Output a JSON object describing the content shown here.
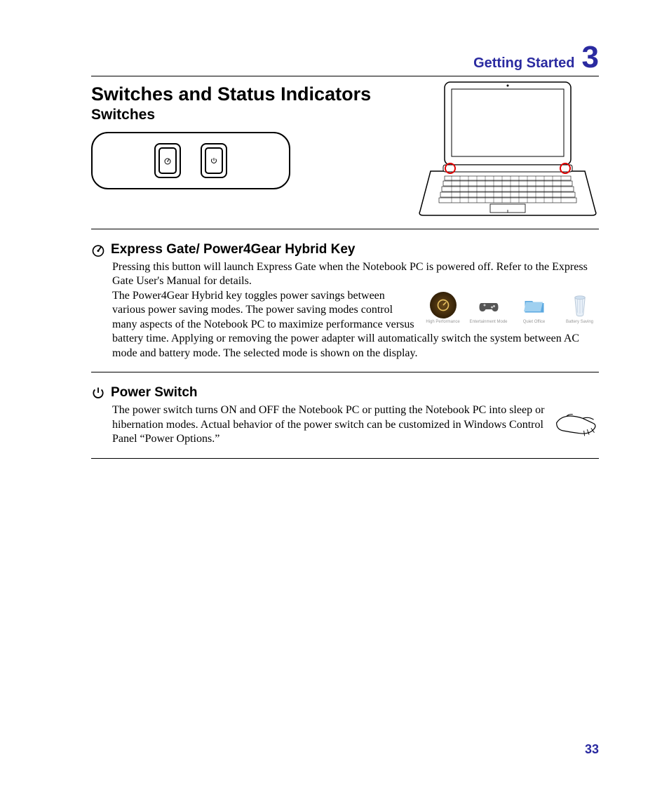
{
  "chapter": {
    "title": "Getting Started",
    "number": "3"
  },
  "section": {
    "title": "Switches and Status Indicators",
    "subtitle": "Switches"
  },
  "express_gate": {
    "title": "Express Gate/ Power4Gear Hybrid Key",
    "para1": "Pressing this button will launch Express Gate when the Notebook PC is powered off. Refer to the Express Gate User's Manual for details.",
    "para2a": "The Power4Gear Hybrid key toggles power savings between various power saving modes. The power saving modes control many aspects of the Notebook PC to maximize performance versus battery time. Applying or removing the power adapter",
    "para2b": "will automatically switch the system between AC mode and battery mode. The selected mode is shown on the display."
  },
  "modes": [
    {
      "label": "High Performance"
    },
    {
      "label": "Entertainment Mode"
    },
    {
      "label": "Quiet Office"
    },
    {
      "label": "Battery Saving"
    }
  ],
  "power_switch": {
    "title": "Power Switch",
    "para": "The power switch turns ON and OFF the Notebook PC or putting the Notebook PC into sleep or hibernation modes. Actual behavior of the power switch can be customized in Windows Control Panel “Power Options.”"
  },
  "page_number": "33"
}
